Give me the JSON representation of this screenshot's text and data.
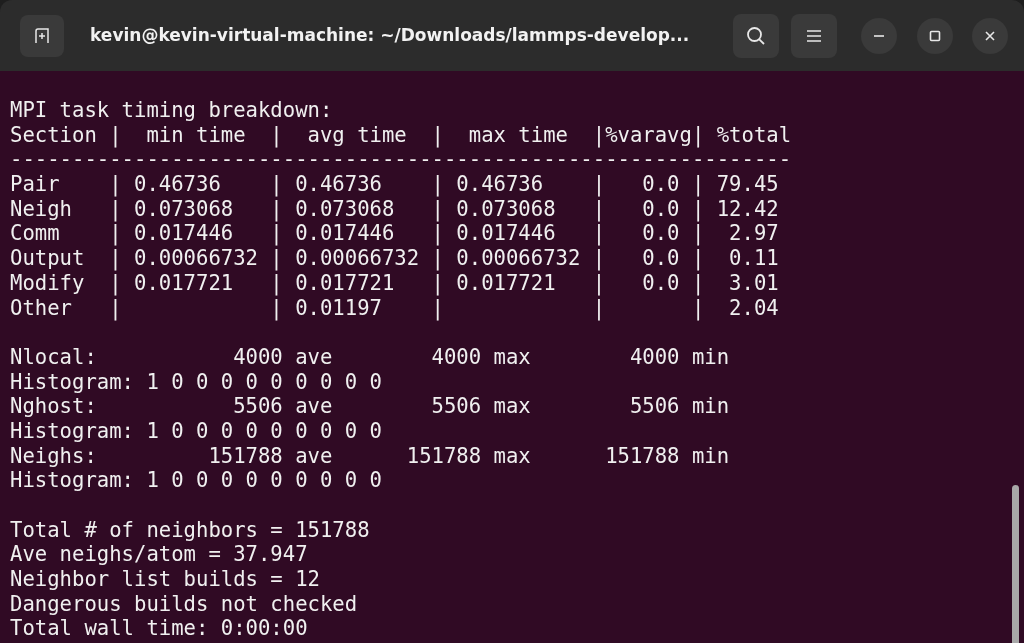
{
  "window": {
    "title": "kevin@kevin-virtual-machine: ~/Downloads/lammps-develop..."
  },
  "terminal": {
    "blocks": [
      {
        "lines": [
          "MPI task timing breakdown:",
          "Section |  min time  |  avg time  |  max time  |%varavg| %total",
          "---------------------------------------------------------------",
          "Pair    | 0.46736    | 0.46736    | 0.46736    |   0.0 | 79.45",
          "Neigh   | 0.073068   | 0.073068   | 0.073068   |   0.0 | 12.42",
          "Comm    | 0.017446   | 0.017446   | 0.017446   |   0.0 |  2.97",
          "Output  | 0.00066732 | 0.00066732 | 0.00066732 |   0.0 |  0.11",
          "Modify  | 0.017721   | 0.017721   | 0.017721   |   0.0 |  3.01",
          "Other   |            | 0.01197    |            |       |  2.04"
        ]
      },
      {
        "lines": [
          "Nlocal:           4000 ave        4000 max        4000 min",
          "Histogram: 1 0 0 0 0 0 0 0 0 0",
          "Nghost:           5506 ave        5506 max        5506 min",
          "Histogram: 1 0 0 0 0 0 0 0 0 0",
          "Neighs:         151788 ave      151788 max      151788 min",
          "Histogram: 1 0 0 0 0 0 0 0 0 0"
        ]
      },
      {
        "lines": [
          "Total # of neighbors = 151788",
          "Ave neighs/atom = 37.947",
          "Neighbor list builds = 12",
          "Dangerous builds not checked",
          "Total wall time: 0:00:00"
        ]
      }
    ]
  }
}
